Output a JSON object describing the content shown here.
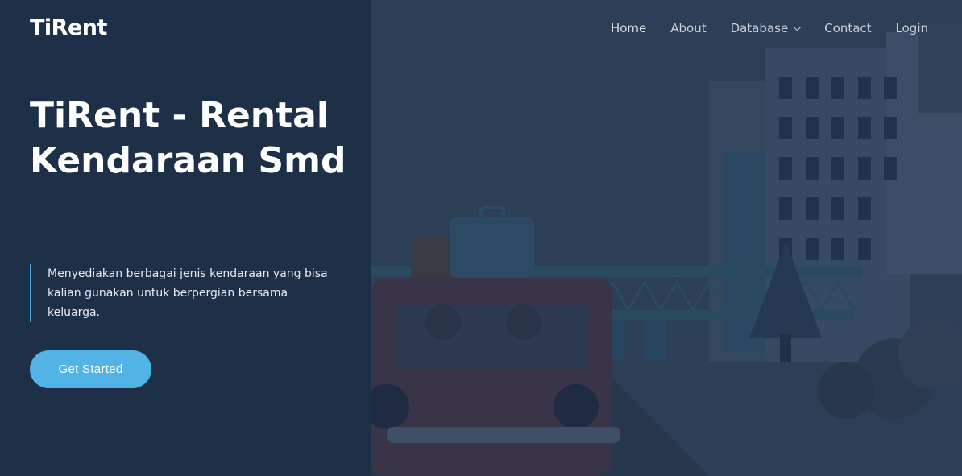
{
  "brand": {
    "name": "TiRent"
  },
  "nav": {
    "items": [
      {
        "label": "Home"
      },
      {
        "label": "About"
      },
      {
        "label": "Database"
      },
      {
        "label": "Contact"
      },
      {
        "label": "Login"
      }
    ]
  },
  "hero": {
    "title": "TiRent - Rental Kendaraan Smd",
    "description": "Menyediakan berbagai jenis kendaraan yang bisa kalian gunakan untuk berpergian bersama keluarga.",
    "cta_label": "Get Started"
  },
  "colors": {
    "left_panel": "#1e3048",
    "hero_overlay": "#2c3e55",
    "accent": "#52b4e6"
  }
}
